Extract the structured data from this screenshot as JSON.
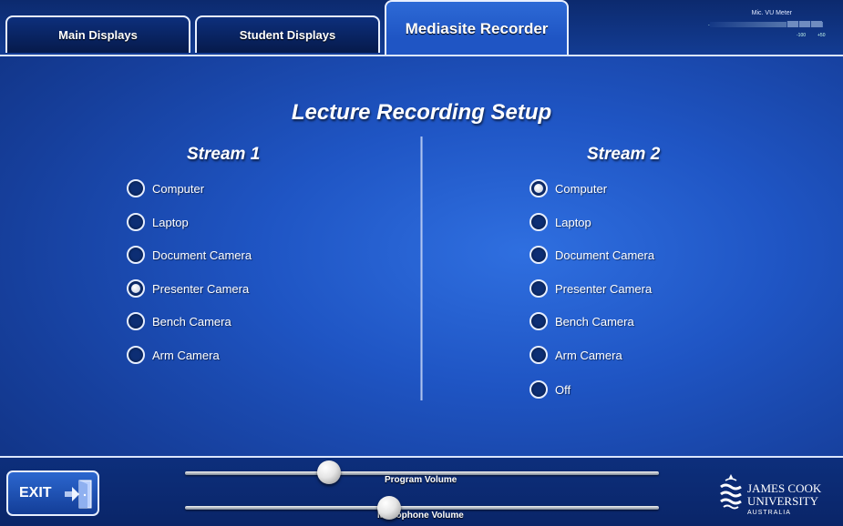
{
  "tabs": {
    "main_displays": "Main Displays",
    "student_displays": "Student Displays",
    "mediasite_recorder": "Mediasite Recorder"
  },
  "vu_meter": {
    "title": "Mic. VU Meter",
    "label_min": "-",
    "label_mid": "-100",
    "label_max": "+50"
  },
  "page_title": "Lecture Recording Setup",
  "stream1": {
    "title": "Stream 1",
    "options": [
      "Computer",
      "Laptop",
      "Document Camera",
      "Presenter Camera",
      "Bench Camera",
      "Arm Camera"
    ],
    "selected": "Presenter Camera"
  },
  "stream2": {
    "title": "Stream 2",
    "options": [
      "Computer",
      "Laptop",
      "Document Camera",
      "Presenter Camera",
      "Bench Camera",
      "Arm Camera",
      "Off"
    ],
    "selected": "Computer"
  },
  "exit": {
    "label": "EXIT"
  },
  "sliders": {
    "program_volume": {
      "label": "Program Volume",
      "value": 0.31
    },
    "microphone_volume": {
      "label": "Microphone Volume",
      "value": 0.43
    }
  },
  "logo": {
    "line1": "JAMES COOK",
    "line2": "UNIVERSITY",
    "line3": "AUSTRALIA"
  },
  "colors": {
    "background": "#1f55c4",
    "bar": "#0d2f7c",
    "border": "#e6eeff"
  }
}
